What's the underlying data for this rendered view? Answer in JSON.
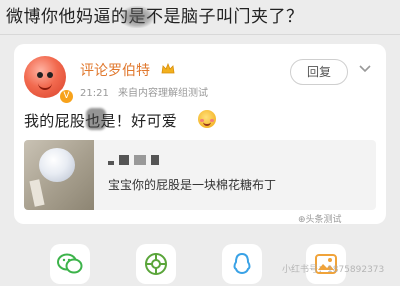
{
  "top_text": "微博你他妈逼的是不是脑子叫门夹了？",
  "post": {
    "username": "评论罗伯特",
    "time": "21:21",
    "source": "来自内容理解组测试",
    "follow_label": "回复",
    "body": "我的屁股也是！好可爱",
    "verified_mark": "V"
  },
  "quote": {
    "text": "宝宝你的屁股是一块棉花糖布丁"
  },
  "watermarks": {
    "mid": "⊕头条测试",
    "bottom": "小红书号：1875892373"
  },
  "icons": {
    "share": [
      "wechat-icon",
      "moments-icon",
      "qq-icon",
      "gallery-icon"
    ],
    "crown": "crown-icon",
    "more": "chevron-down-icon",
    "emoji": "blush-emoji-icon"
  },
  "colors": {
    "username": "#e0782e",
    "wechat": "#3cb34a",
    "moments": "#5aa53a",
    "qq": "#3aa2e6",
    "gallery": "#f0a33a"
  }
}
